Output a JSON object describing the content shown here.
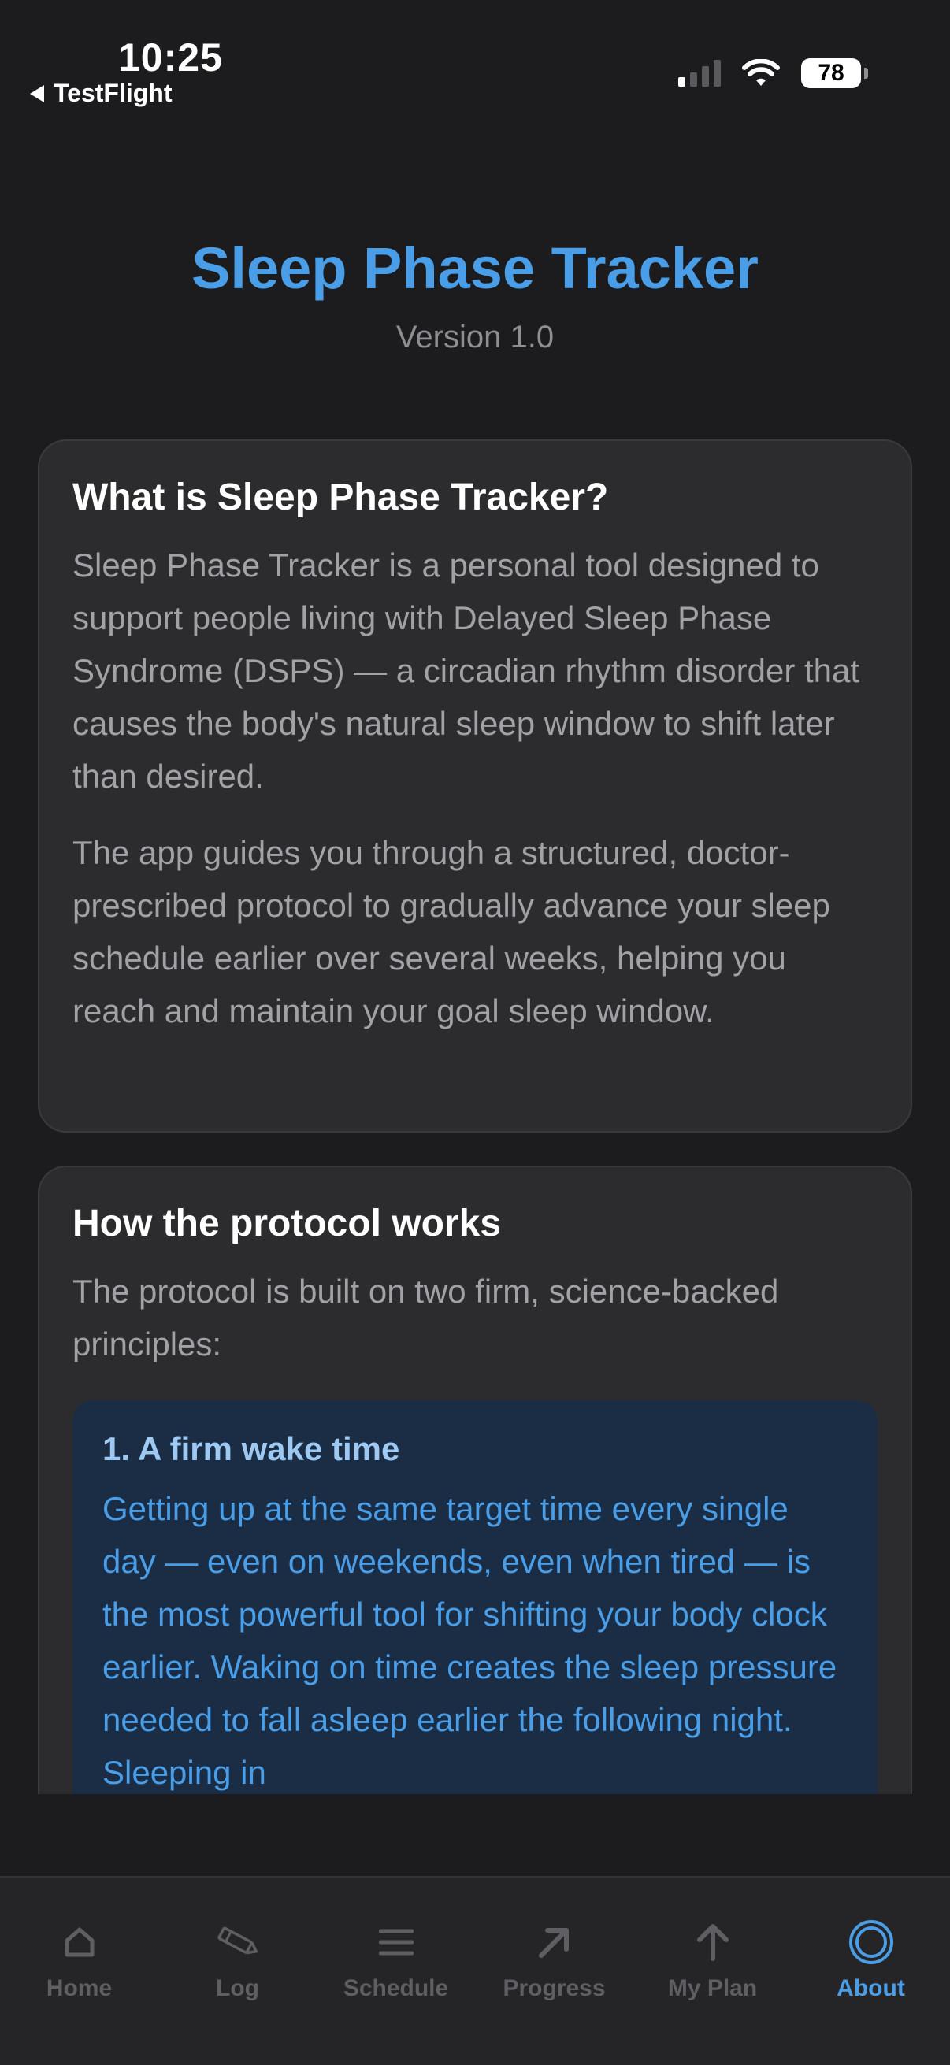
{
  "status_bar": {
    "time": "10:25",
    "back_label": "TestFlight",
    "battery": "78",
    "icons": [
      "cellular-signal-icon",
      "wifi-icon",
      "battery-icon"
    ]
  },
  "header": {
    "title": "Sleep Phase Tracker",
    "version": "Version 1.0"
  },
  "sections": {
    "about": {
      "title": "What is Sleep Phase Tracker?",
      "paragraphs": [
        "Sleep Phase Tracker is a personal tool designed to support people living with Delayed Sleep Phase Syndrome (DSPS) — a circadian rhythm disorder that causes the body's natural sleep window to shift later than desired.",
        "The app guides you through a structured, doctor-prescribed protocol to gradually advance your sleep schedule earlier over several weeks, helping you reach and maintain your goal sleep window."
      ]
    },
    "protocol": {
      "title": "How the protocol works",
      "intro": "The protocol is built on two firm, science-backed principles:",
      "principles": [
        {
          "title": "1. A firm wake time",
          "text": "Getting up at the same target time every single day — even on weekends, even when tired — is the most powerful tool for shifting your body clock earlier. Waking on time creates the sleep pressure needed to fall asleep earlier the following night. Sleeping in"
        }
      ]
    }
  },
  "tab_bar": {
    "tabs": [
      {
        "label": "Home",
        "icon": "home-icon"
      },
      {
        "label": "Log",
        "icon": "pencil-icon"
      },
      {
        "label": "Schedule",
        "icon": "list-icon"
      },
      {
        "label": "Progress",
        "icon": "arrow-up-right-icon"
      },
      {
        "label": "My Plan",
        "icon": "arrow-up-icon"
      },
      {
        "label": "About",
        "icon": "circle-icon"
      }
    ],
    "active_tab": "About"
  },
  "colors": {
    "background": "#1c1c1e",
    "card": "#2c2c2e",
    "accent": "#4a9ee8",
    "principle_box": "#1a2d45",
    "inactive_tab": "#5f5f63"
  }
}
